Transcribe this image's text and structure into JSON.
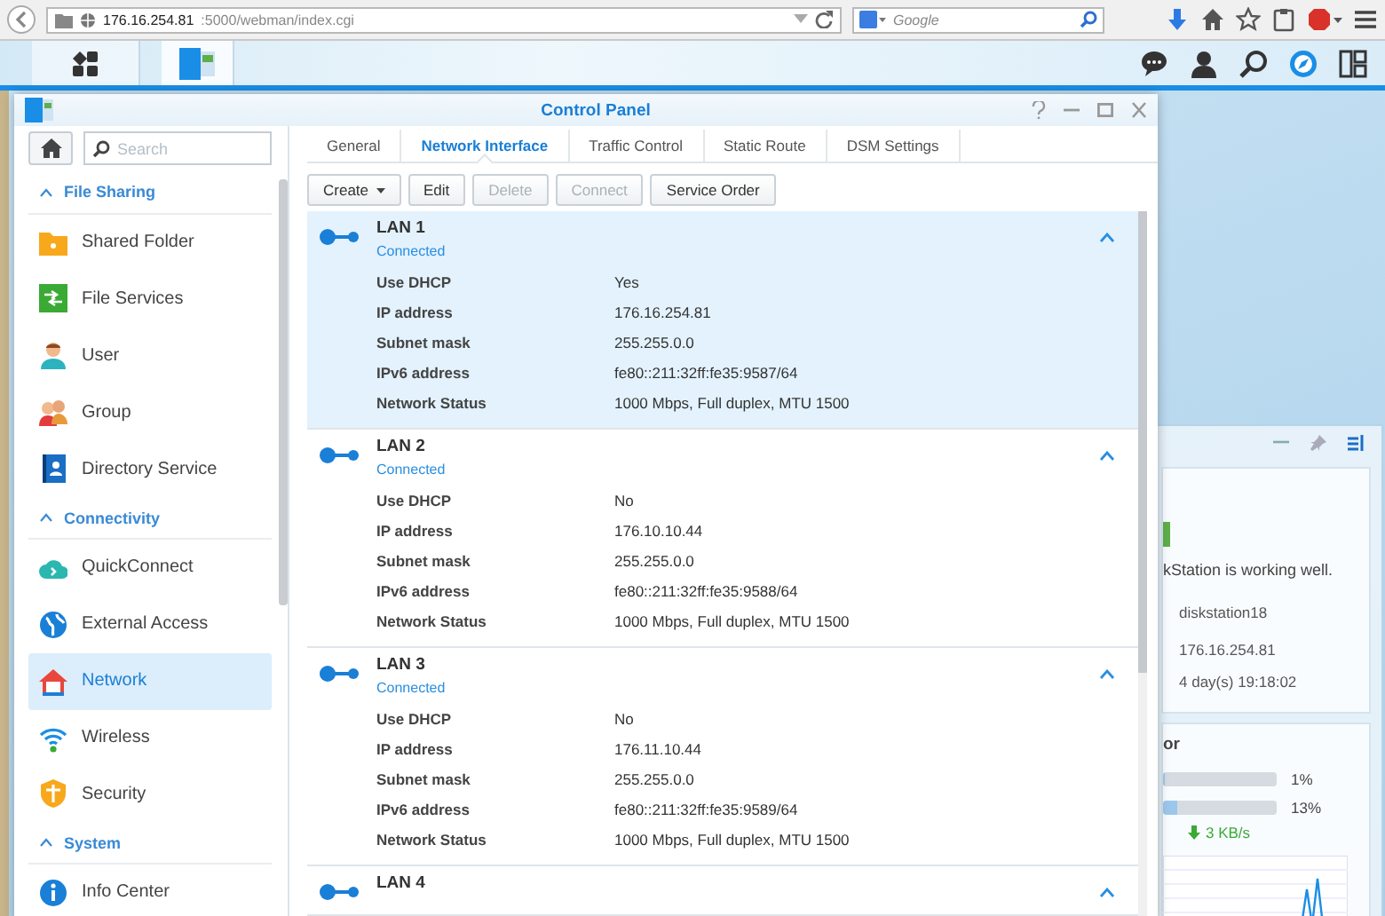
{
  "browser": {
    "url_host": "176.16.254.81",
    "url_path": ":5000/webman/index.cgi",
    "search_placeholder": "Google"
  },
  "window": {
    "title": "Control Panel"
  },
  "sidebar": {
    "search_placeholder": "Search",
    "sections": [
      {
        "title": "File Sharing",
        "expanded": true,
        "items": [
          {
            "label": "Shared Folder",
            "selected": false
          },
          {
            "label": "File Services",
            "selected": false
          },
          {
            "label": "User",
            "selected": false
          },
          {
            "label": "Group",
            "selected": false
          },
          {
            "label": "Directory Service",
            "selected": false
          }
        ]
      },
      {
        "title": "Connectivity",
        "expanded": true,
        "items": [
          {
            "label": "QuickConnect",
            "selected": false
          },
          {
            "label": "External Access",
            "selected": false
          },
          {
            "label": "Network",
            "selected": true
          },
          {
            "label": "Wireless",
            "selected": false
          },
          {
            "label": "Security",
            "selected": false
          }
        ]
      },
      {
        "title": "System",
        "expanded": true,
        "items": [
          {
            "label": "Info Center",
            "selected": false
          }
        ]
      }
    ]
  },
  "tabs": [
    {
      "label": "General",
      "selected": false
    },
    {
      "label": "Network Interface",
      "selected": true
    },
    {
      "label": "Traffic Control",
      "selected": false
    },
    {
      "label": "Static Route",
      "selected": false
    },
    {
      "label": "DSM Settings",
      "selected": false
    }
  ],
  "toolbar": [
    {
      "label": "Create",
      "kind": "dropdown",
      "disabled": false
    },
    {
      "label": "Edit",
      "kind": "button",
      "disabled": false
    },
    {
      "label": "Delete",
      "kind": "button",
      "disabled": true
    },
    {
      "label": "Connect",
      "kind": "button",
      "disabled": true
    },
    {
      "label": "Service Order",
      "kind": "button",
      "disabled": false
    }
  ],
  "interfaces": [
    {
      "name": "LAN 1",
      "status": "Connected",
      "selected": true,
      "expanded": true,
      "fields": [
        {
          "label": "Use DHCP",
          "value": "Yes"
        },
        {
          "label": "IP address",
          "value": "176.16.254.81"
        },
        {
          "label": "Subnet mask",
          "value": "255.255.0.0"
        },
        {
          "label": "IPv6 address",
          "value": "fe80::211:32ff:fe35:9587/64"
        },
        {
          "label": "Network Status",
          "value": "1000 Mbps, Full duplex, MTU 1500"
        }
      ]
    },
    {
      "name": "LAN 2",
      "status": "Connected",
      "selected": false,
      "expanded": true,
      "fields": [
        {
          "label": "Use DHCP",
          "value": "No"
        },
        {
          "label": "IP address",
          "value": "176.10.10.44"
        },
        {
          "label": "Subnet mask",
          "value": "255.255.0.0"
        },
        {
          "label": "IPv6 address",
          "value": "fe80::211:32ff:fe35:9588/64"
        },
        {
          "label": "Network Status",
          "value": "1000 Mbps, Full duplex, MTU 1500"
        }
      ]
    },
    {
      "name": "LAN 3",
      "status": "Connected",
      "selected": false,
      "expanded": true,
      "fields": [
        {
          "label": "Use DHCP",
          "value": "No"
        },
        {
          "label": "IP address",
          "value": "176.11.10.44"
        },
        {
          "label": "Subnet mask",
          "value": "255.255.0.0"
        },
        {
          "label": "IPv6 address",
          "value": "fe80::211:32ff:fe35:9589/64"
        },
        {
          "label": "Network Status",
          "value": "1000 Mbps, Full duplex, MTU 1500"
        }
      ]
    },
    {
      "name": "LAN 4",
      "selected": false,
      "expanded": true
    }
  ],
  "widgets": {
    "health": {
      "message": "kStation is working well.",
      "rows": [
        "diskstation18",
        "176.16.254.81",
        "4 day(s) 19:18:02"
      ]
    },
    "resource": {
      "title": "or",
      "meters": [
        {
          "level": 0.01,
          "reading": "1%"
        },
        {
          "level": 0.13,
          "reading": "13%"
        }
      ],
      "download": "3 KB/s"
    }
  }
}
